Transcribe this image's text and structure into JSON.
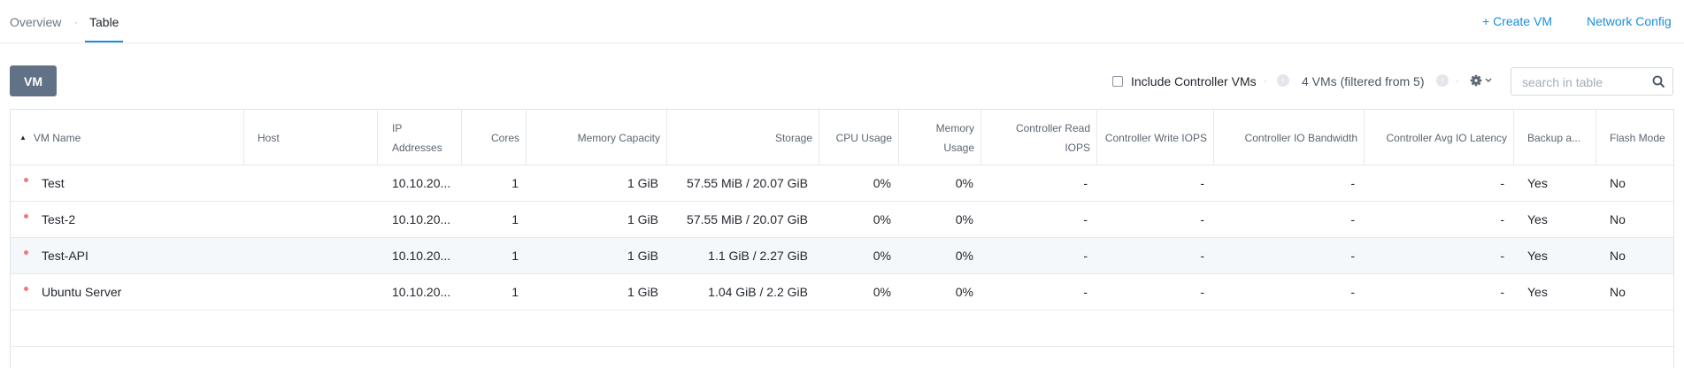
{
  "tabs": {
    "overview": "Overview",
    "separator": "·",
    "table": "Table"
  },
  "actions": {
    "create_vm": "+ Create VM",
    "network_config": "Network Config"
  },
  "toolbar": {
    "vm_button": "VM",
    "include_controller_label": "Include Controller VMs",
    "include_controller_checked": false,
    "dot": "·",
    "vm_count": "4 VMs (filtered from 5)",
    "search_placeholder": "search in table"
  },
  "table": {
    "columns": {
      "vm_name": "VM Name",
      "host": "Host",
      "ip_line1": "IP",
      "ip_line2": "Addresses",
      "cores": "Cores",
      "memory_capacity": "Memory Capacity",
      "storage": "Storage",
      "cpu_usage": "CPU Usage",
      "memory_usage": "Memory Usage",
      "ctrl_read_iops": "Controller Read IOPS",
      "ctrl_write_iops": "Controller Write IOPS",
      "ctrl_io_bandwidth": "Controller IO Bandwidth",
      "ctrl_avg_io_latency": "Controller Avg IO Latency",
      "backup": "Backup a...",
      "flash_mode": "Flash Mode"
    },
    "rows": [
      {
        "name": "Test",
        "host": "",
        "ip": "10.10.20...",
        "cores": "1",
        "memory": "1 GiB",
        "storage": "57.55 MiB / 20.07 GiB",
        "cpu": "0%",
        "mem_usage": "0%",
        "read_iops": "-",
        "write_iops": "-",
        "bandwidth": "-",
        "latency": "-",
        "backup": "Yes",
        "flash": "No"
      },
      {
        "name": "Test-2",
        "host": "",
        "ip": "10.10.20...",
        "cores": "1",
        "memory": "1 GiB",
        "storage": "57.55 MiB / 20.07 GiB",
        "cpu": "0%",
        "mem_usage": "0%",
        "read_iops": "-",
        "write_iops": "-",
        "bandwidth": "-",
        "latency": "-",
        "backup": "Yes",
        "flash": "No"
      },
      {
        "name": "Test-API",
        "host": "",
        "ip": "10.10.20...",
        "cores": "1",
        "memory": "1 GiB",
        "storage": "1.1 GiB / 2.27 GiB",
        "cpu": "0%",
        "mem_usage": "0%",
        "read_iops": "-",
        "write_iops": "-",
        "bandwidth": "-",
        "latency": "-",
        "backup": "Yes",
        "flash": "No"
      },
      {
        "name": "Ubuntu Server",
        "host": "",
        "ip": "10.10.20...",
        "cores": "1",
        "memory": "1 GiB",
        "storage": "1.04 GiB / 2.2 GiB",
        "cpu": "0%",
        "mem_usage": "0%",
        "read_iops": "-",
        "write_iops": "-",
        "bandwidth": "-",
        "latency": "-",
        "backup": "Yes",
        "flash": "No"
      }
    ]
  },
  "colors": {
    "accent": "#1b8edb",
    "vm_button": "#627286",
    "status_dot": "#f0787d",
    "row_highlight": "#f4f8fb"
  }
}
